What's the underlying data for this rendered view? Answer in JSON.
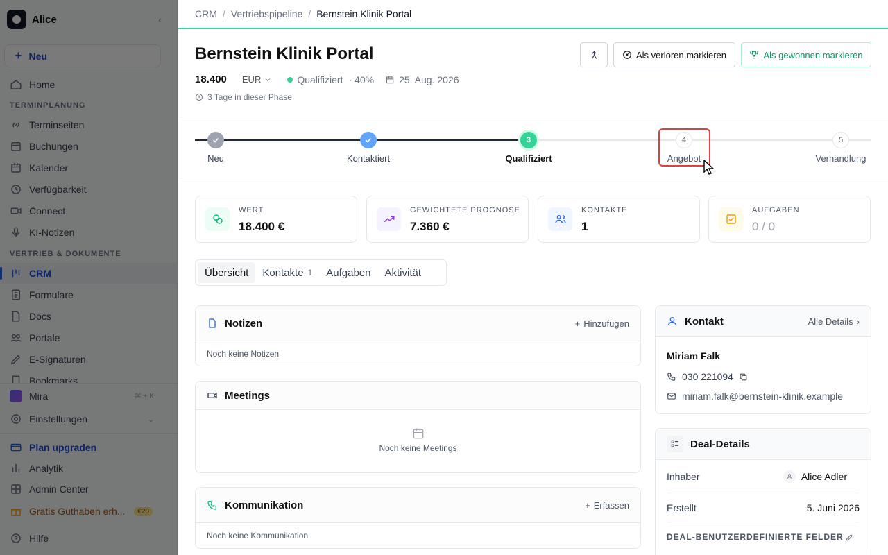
{
  "sidebar": {
    "workspace": "Alice",
    "new_label": "Neu",
    "items": {
      "home": "Home",
      "section_scheduling": "TERMINPLANUNG",
      "booking_pages": "Terminseiten",
      "bookings": "Buchungen",
      "calendar": "Kalender",
      "availability": "Verfügbarkeit",
      "connect": "Connect",
      "ai_notes": "KI-Notizen",
      "section_sales": "VERTRIEB & DOKUMENTE",
      "crm": "CRM",
      "forms": "Formulare",
      "docs": "Docs",
      "portals": "Portale",
      "esign": "E-Signaturen",
      "cutoff": "Bookmarks",
      "mira": "Mira",
      "mira_kbd": "⌘ + K",
      "settings": "Einstellungen",
      "upgrade": "Plan upgraden",
      "analytics": "Analytik",
      "admin": "Admin Center",
      "credit": "Gratis Guthaben erh...",
      "credit_badge": "€20",
      "help": "Hilfe"
    }
  },
  "breadcrumb": [
    "CRM",
    "/",
    "Vertriebspipeline",
    "/",
    "Bernstein Klinik Portal"
  ],
  "deal": {
    "title": "Bernstein Klinik Portal",
    "amount": "18.400",
    "currency": "EUR",
    "stage": "Qualifiziert",
    "probability": "· 40%",
    "close_date": "25. Aug. 2026",
    "time_in_phase": "3 Tage in dieser Phase"
  },
  "actions": {
    "lost": "Als verloren markieren",
    "won": "Als gewonnen markieren"
  },
  "stepper": [
    {
      "label": "Neu",
      "state": "done"
    },
    {
      "label": "Kontaktiert",
      "state": "done"
    },
    {
      "number": "3",
      "label": "Qualifiziert",
      "state": "current"
    },
    {
      "number": "4",
      "label": "Angebot",
      "state": "todo"
    },
    {
      "number": "5",
      "label": "Verhandlung",
      "state": "todo"
    }
  ],
  "cards": [
    {
      "label": "WERT",
      "value": "18.400 €"
    },
    {
      "label": "GEWICHTETE PROGNOSE",
      "value": "7.360 €"
    },
    {
      "label": "KONTAKTE",
      "value": "1"
    },
    {
      "label": "AUFGABEN",
      "value": "0 / 0"
    }
  ],
  "tabs": {
    "overview": "Übersicht",
    "contacts": "Kontakte",
    "contacts_count": "1",
    "tasks": "Aufgaben",
    "activity": "Aktivität"
  },
  "notes": {
    "title": "Notizen",
    "action": "Hinzufügen",
    "empty": "Noch keine Notizen"
  },
  "meetings": {
    "title": "Meetings",
    "empty": "Noch keine Meetings"
  },
  "communication": {
    "title": "Kommunikation",
    "action": "Erfassen",
    "empty": "Noch keine Kommunikation"
  },
  "contact": {
    "title": "Kontakt",
    "details_link": "Alle Details",
    "name": "Miriam Falk",
    "phone": "030 221094",
    "email": "miriam.falk@bernstein-klinik.example"
  },
  "deal_details": {
    "title": "Deal-Details",
    "owner_label": "Inhaber",
    "owner_value": "Alice Adler",
    "created_label": "Erstellt",
    "created_value": "5. Juni 2026",
    "custom_fields": "DEAL-BENUTZERDEFINIERTE FELDER"
  },
  "colors": {
    "accent": "#2563eb",
    "success": "#34d399",
    "highlight": "#e53e3e"
  }
}
